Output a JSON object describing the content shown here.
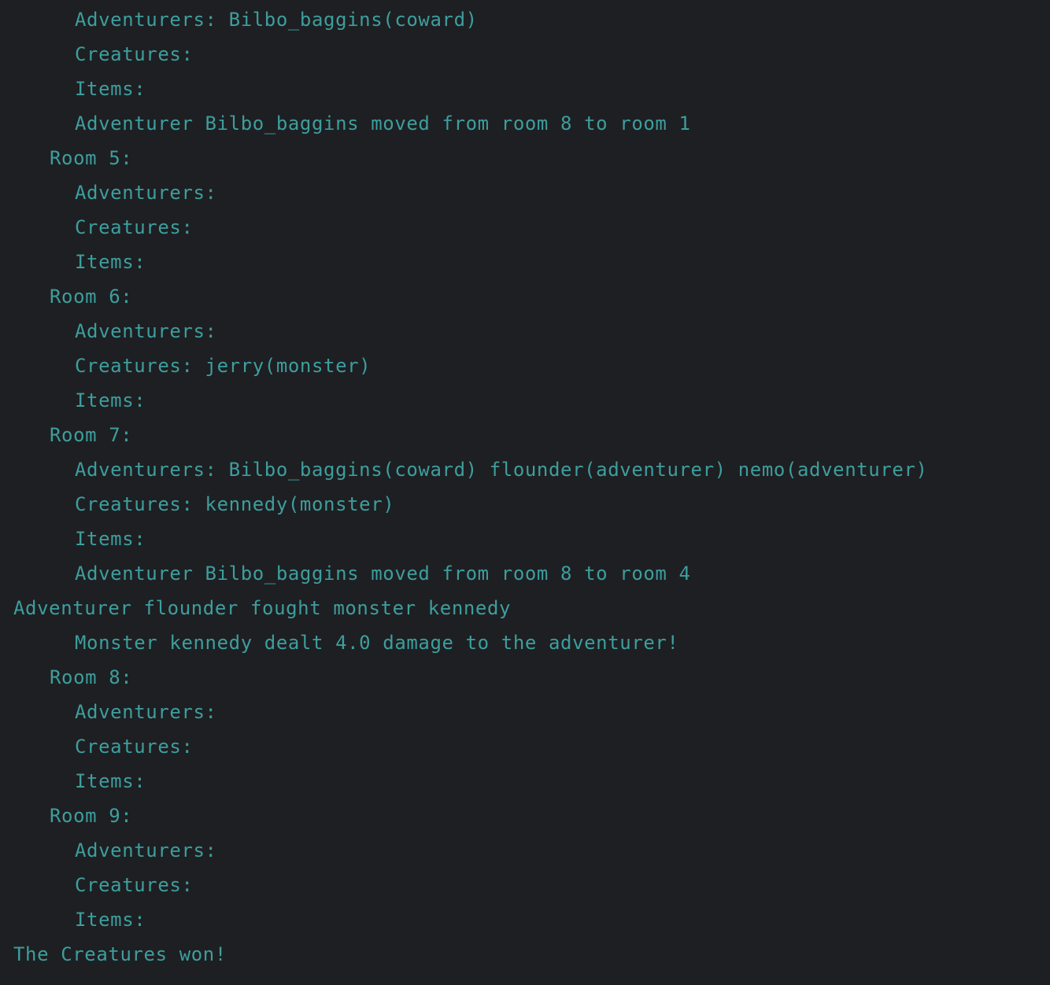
{
  "console": {
    "lines": [
      "Adventurers: Bilbo_baggins(coward)",
      "Creatures:",
      "Items:",
      "Adventurer Bilbo_baggins moved from room 8 to room 1",
      "Room 5:",
      "Adventurers:",
      "Creatures:",
      "Items:",
      "Room 6:",
      "Adventurers:",
      "Creatures: jerry(monster)",
      "Items:",
      "Room 7:",
      "Adventurers: Bilbo_baggins(coward) flounder(adventurer) nemo(adventurer)",
      "Creatures: kennedy(monster)",
      "Items:",
      "Adventurer Bilbo_baggins moved from room 8 to room 4",
      "Adventurer flounder fought monster kennedy",
      "Monster kennedy dealt 4.0 damage to the adventurer!",
      "Room 8:",
      "Adventurers:",
      "Creatures:",
      "Items:",
      "Room 9:",
      "Adventurers:",
      "Creatures:",
      "Items:",
      "The Creatures won!"
    ]
  },
  "colors": {
    "background": "#1e1f22",
    "text": "#3d9e9e"
  }
}
